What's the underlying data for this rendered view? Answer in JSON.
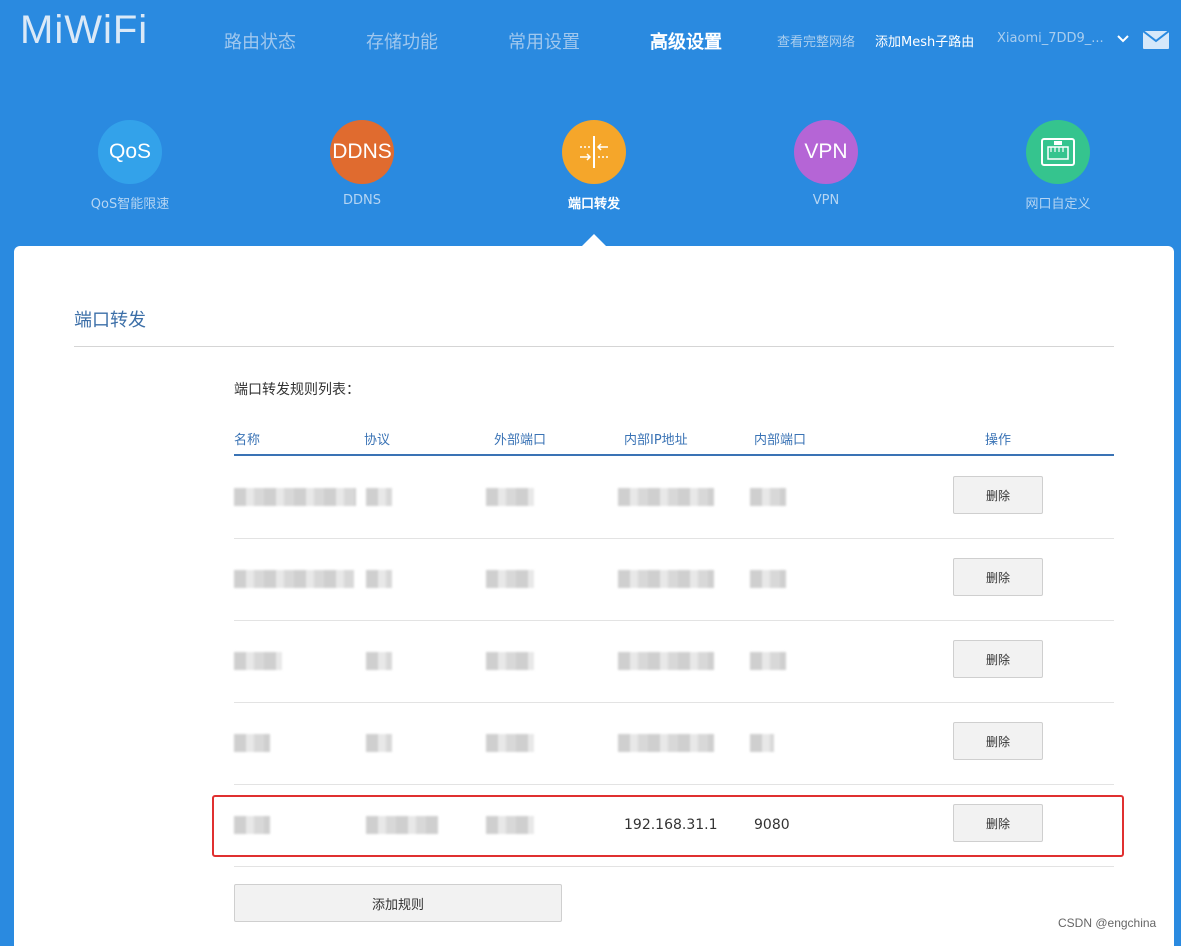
{
  "header": {
    "logo": "MiWiFi",
    "nav": [
      "路由状态",
      "存储功能",
      "常用设置",
      "高级设置"
    ],
    "active_nav": "高级设置",
    "view_network": "查看完整网络",
    "add_mesh": "添加Mesh子路由",
    "router_name": "Xiaomi_7DD9_..."
  },
  "features": [
    {
      "icon_text": "QoS",
      "label": "QoS智能限速",
      "color": "#33a2ea"
    },
    {
      "icon_text": "DDNS",
      "label": "DDNS",
      "color": "#e06b2f"
    },
    {
      "icon_text": "",
      "label": "端口转发",
      "color": "#f5a62a"
    },
    {
      "icon_text": "VPN",
      "label": "VPN",
      "color": "#b565d6"
    },
    {
      "icon_text": "",
      "label": "网口自定义",
      "color": "#35c48e"
    }
  ],
  "panel": {
    "title": "端口转发",
    "list_title": "端口转发规则列表：",
    "columns": [
      "名称",
      "协议",
      "外部端口",
      "内部IP地址",
      "内部端口",
      "操作"
    ],
    "rows": [
      {
        "name": "",
        "protocol": "",
        "ext_port": "",
        "ip": "",
        "int_port": "",
        "action": "删除"
      },
      {
        "name": "",
        "protocol": "",
        "ext_port": "",
        "ip": "",
        "int_port": "",
        "action": "删除"
      },
      {
        "name": "",
        "protocol": "",
        "ext_port": "",
        "ip": "",
        "int_port": "",
        "action": "删除"
      },
      {
        "name": "",
        "protocol": "",
        "ext_port": "",
        "ip": "",
        "int_port": "",
        "action": "删除"
      },
      {
        "name": "",
        "protocol": "",
        "ext_port": "",
        "ip": "192.168.31.1",
        "int_port": "9080",
        "action": "删除"
      }
    ],
    "add_button": "添加规则"
  },
  "watermark": "CSDN @engchina"
}
